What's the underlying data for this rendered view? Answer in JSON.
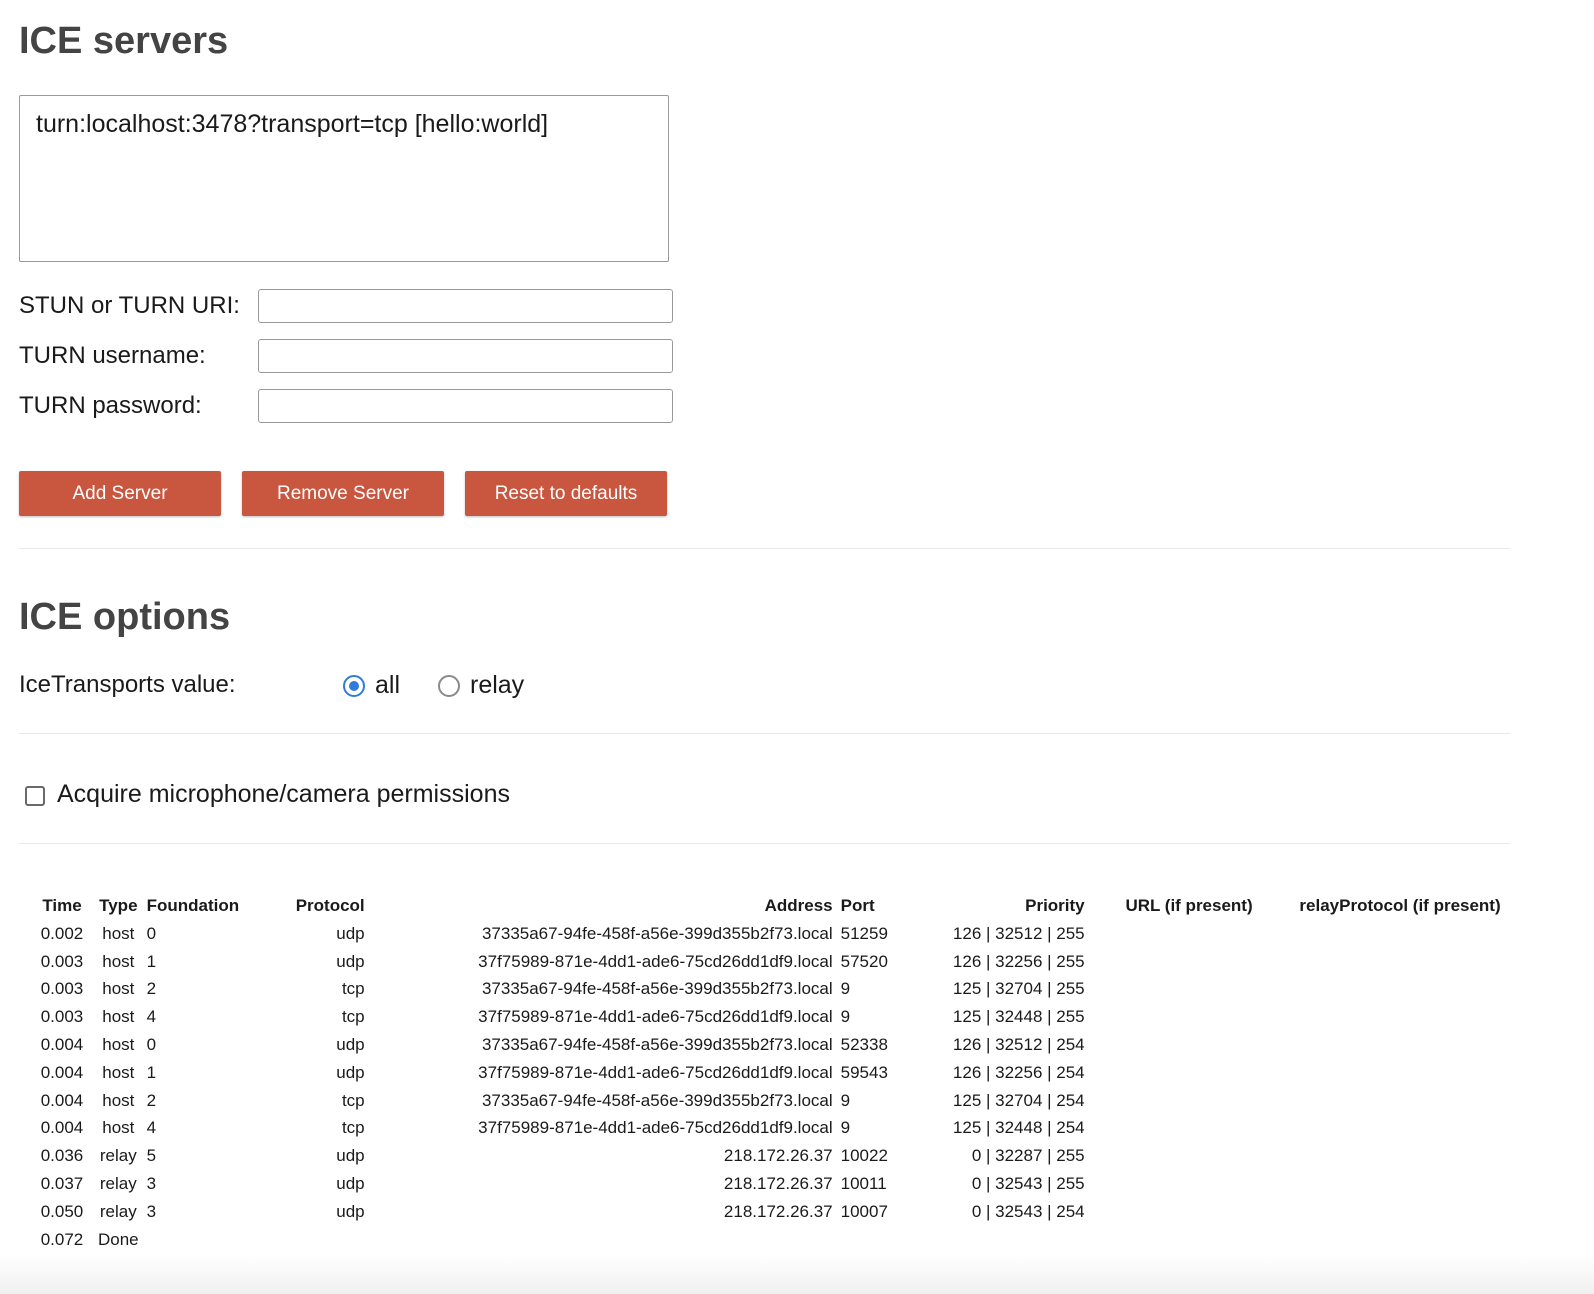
{
  "ice_servers": {
    "title": "ICE servers",
    "server_list": "turn:localhost:3478?transport=tcp [hello:world]",
    "uri_label": "STUN or TURN URI:",
    "username_label": "TURN username:",
    "password_label": "TURN password:",
    "uri_value": "",
    "username_value": "",
    "password_value": "",
    "add_label": "Add Server",
    "remove_label": "Remove Server",
    "reset_label": "Reset to defaults"
  },
  "ice_options": {
    "title": "ICE options",
    "transports_label": "IceTransports value:",
    "option_all": "all",
    "option_relay": "relay",
    "selected": "all",
    "permissions_label": "Acquire microphone/camera permissions",
    "permissions_checked": false
  },
  "candidates": {
    "headers": [
      "Time",
      "Type",
      "Foundation",
      "Protocol",
      "Address",
      "Port",
      "Priority",
      "URL (if present)",
      "relayProtocol (if present)"
    ],
    "rows": [
      [
        "0.002",
        "host",
        "0",
        "udp",
        "37335a67-94fe-458f-a56e-399d355b2f73.local",
        "51259",
        "126 | 32512 | 255",
        "",
        ""
      ],
      [
        "0.003",
        "host",
        "1",
        "udp",
        "37f75989-871e-4dd1-ade6-75cd26dd1df9.local",
        "57520",
        "126 | 32256 | 255",
        "",
        ""
      ],
      [
        "0.003",
        "host",
        "2",
        "tcp",
        "37335a67-94fe-458f-a56e-399d355b2f73.local",
        "9",
        "125 | 32704 | 255",
        "",
        ""
      ],
      [
        "0.003",
        "host",
        "4",
        "tcp",
        "37f75989-871e-4dd1-ade6-75cd26dd1df9.local",
        "9",
        "125 | 32448 | 255",
        "",
        ""
      ],
      [
        "0.004",
        "host",
        "0",
        "udp",
        "37335a67-94fe-458f-a56e-399d355b2f73.local",
        "52338",
        "126 | 32512 | 254",
        "",
        ""
      ],
      [
        "0.004",
        "host",
        "1",
        "udp",
        "37f75989-871e-4dd1-ade6-75cd26dd1df9.local",
        "59543",
        "126 | 32256 | 254",
        "",
        ""
      ],
      [
        "0.004",
        "host",
        "2",
        "tcp",
        "37335a67-94fe-458f-a56e-399d355b2f73.local",
        "9",
        "125 | 32704 | 254",
        "",
        ""
      ],
      [
        "0.004",
        "host",
        "4",
        "tcp",
        "37f75989-871e-4dd1-ade6-75cd26dd1df9.local",
        "9",
        "125 | 32448 | 254",
        "",
        ""
      ],
      [
        "0.036",
        "relay",
        "5",
        "udp",
        "218.172.26.37",
        "10022",
        "0 | 32287 | 255",
        "",
        ""
      ],
      [
        "0.037",
        "relay",
        "3",
        "udp",
        "218.172.26.37",
        "10011",
        "0 | 32543 | 255",
        "",
        ""
      ],
      [
        "0.050",
        "relay",
        "3",
        "udp",
        "218.172.26.37",
        "10007",
        "0 | 32543 | 254",
        "",
        ""
      ]
    ],
    "done_time": "0.072",
    "done_label": "Done"
  },
  "colors": {
    "button": "#c9563f",
    "radio_accent": "#2f7bde",
    "heading": "#444444"
  }
}
